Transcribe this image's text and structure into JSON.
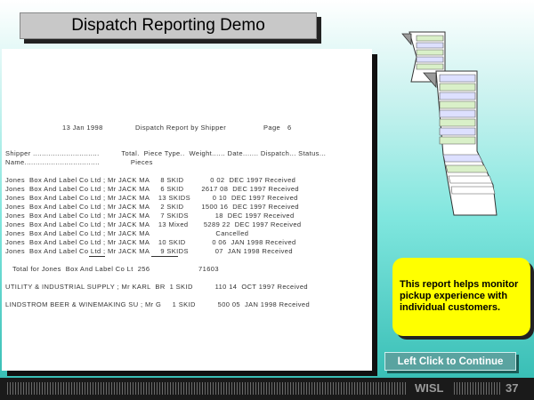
{
  "slide": {
    "title": "Dispatch Reporting Demo",
    "callout": "This report helps monitor pickup experience with individual customers.",
    "continue_label": "Left Click to Continue",
    "footer_label": "WISL",
    "page_number": "37"
  },
  "report": {
    "date": "13 Jan 1998",
    "report_title": "Dispatch Report by Shipper",
    "page_label": "Page",
    "page_value": "6",
    "header_line1": "Shipper ..............................          Total.  Piece Type..  Weight...... Date....... Dispatch... Status...",
    "header_line2": "Name..................................              Pieces",
    "rows": [
      "Jones  Box And Label Co Ltd ; Mr JACK MA     8 SKID            0 02  DEC 1997 Received",
      "Jones  Box And Label Co Ltd ; Mr JACK MA     6 SKID        2617 08  DEC 1997 Received",
      "Jones  Box And Label Co Ltd ; Mr JACK MA    13 SKIDS          0 10  DEC 1997 Received",
      "Jones  Box And Label Co Ltd ; Mr JACK MA     2 SKID        1500 16  DEC 1997 Received",
      "Jones  Box And Label Co Ltd ; Mr JACK MA     7 SKIDS            18  DEC 1997 Received",
      "Jones  Box And Label Co Ltd ; Mr JACK MA    13 Mixed       5289 22  DEC 1997 Received",
      "Jones  Box And Label Co Ltd ; Mr JACK MA                              Cancelled",
      "Jones  Box And Label Co Ltd ; Mr JACK MA    10 SKID            0 06  JAN 1998 Received",
      "Jones  Box And Label Co Ltd ; Mr JACK MA     9 SKIDS            07  JAN 1998 Received"
    ],
    "total_line": "Total for Jones  Box And Label Co Lt  256                      71603",
    "other_rows": [
      "UTILITY & INDUSTRIAL SUPPLY ; Mr KARL  BR  1 SKID          110 14  OCT 1997 Received",
      "LINDSTROM BEER & WINEMAKING SU ; Mr G     1 SKID          500 05  JAN 1998 Received"
    ]
  }
}
